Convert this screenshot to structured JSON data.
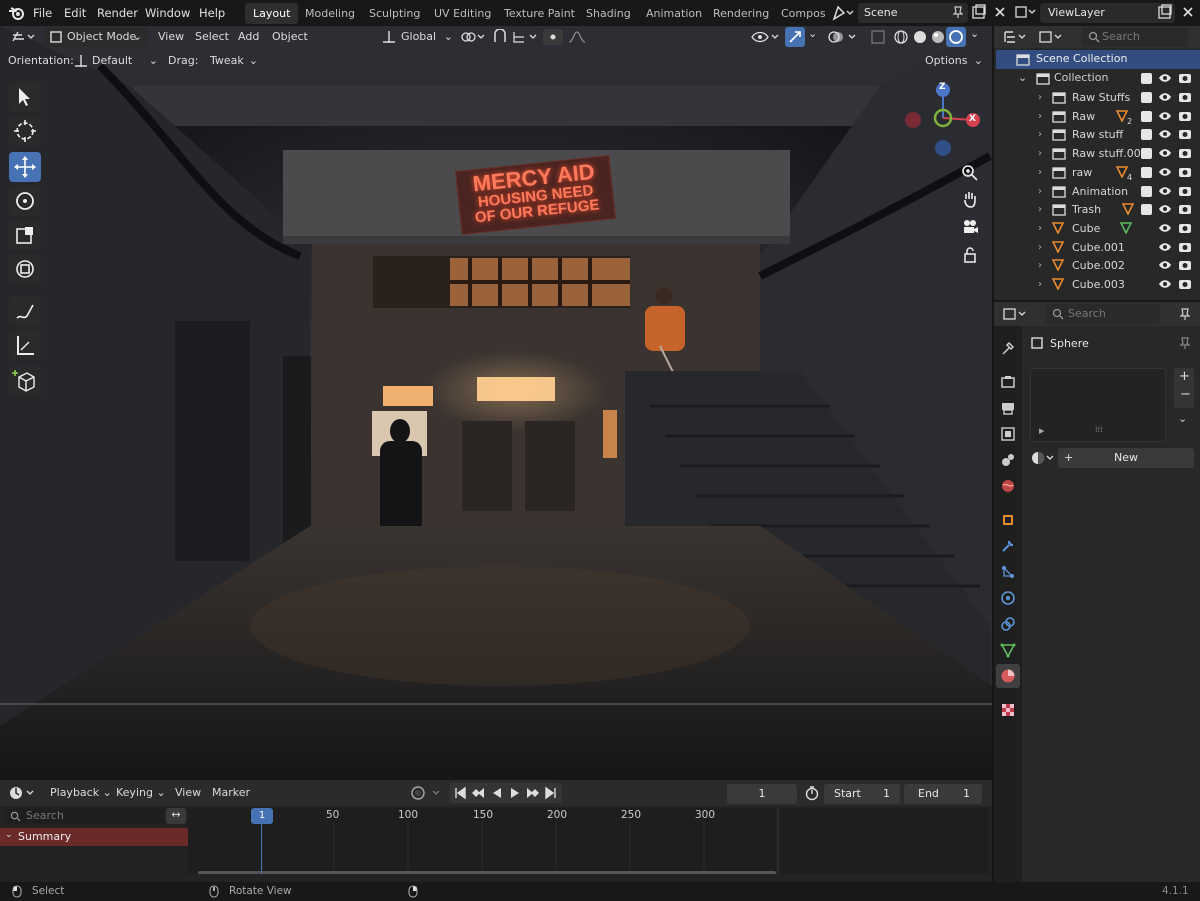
{
  "menu": [
    "File",
    "Edit",
    "Render",
    "Window",
    "Help"
  ],
  "workspaces": [
    "Layout",
    "Modeling",
    "Sculpting",
    "UV Editing",
    "Texture Paint",
    "Shading",
    "Animation",
    "Rendering",
    "Compos"
  ],
  "scene": "Scene",
  "viewlayer": "ViewLayer",
  "viewport_header": {
    "mode": "Object Mode",
    "view": "View",
    "select": "Select",
    "add": "Add",
    "object": "Object",
    "transform": "Global"
  },
  "tool_settings": {
    "orientation_label": "Orientation:",
    "orientation_value": "Default",
    "drag_label": "Drag:",
    "drag_value": "Tweak",
    "options": "Options"
  },
  "gizmo": {
    "x": "X",
    "y": "Y",
    "z": "Z"
  },
  "scene_sign": [
    "MERCY AID",
    "HOUSING NEED",
    "OF OUR REFUGE"
  ],
  "outliner": {
    "search_placeholder": "Search",
    "scene_collection": "Scene Collection",
    "collection": "Collection",
    "items": [
      {
        "label": "Raw Stuffs",
        "badge": ""
      },
      {
        "label": "Raw",
        "badge": "2"
      },
      {
        "label": "Raw stuff",
        "badge": ""
      },
      {
        "label": "Raw stuff.00",
        "badge": ""
      },
      {
        "label": "raw",
        "badge": "4"
      },
      {
        "label": "Animation",
        "badge": ""
      },
      {
        "label": "Trash",
        "badge": ""
      },
      {
        "label": "Cube",
        "badge": ""
      },
      {
        "label": "Cube.001",
        "badge": ""
      },
      {
        "label": "Cube.002",
        "badge": ""
      },
      {
        "label": "Cube.003",
        "badge": ""
      }
    ]
  },
  "properties": {
    "search_placeholder": "Search",
    "object_name": "Sphere",
    "new_button": "New"
  },
  "timeline": {
    "playback": "Playback",
    "keying": "Keying",
    "view": "View",
    "marker": "Marker",
    "current_frame": "1",
    "start_label": "Start",
    "start_value": "1",
    "end_label": "End",
    "end_value": "1",
    "search_placeholder": "Search",
    "summary": "Summary",
    "ruler": [
      "1",
      "50",
      "100",
      "150",
      "200",
      "250",
      "300"
    ]
  },
  "status": {
    "select": "Select",
    "rotate": "Rotate View",
    "version": "4.1.1"
  }
}
